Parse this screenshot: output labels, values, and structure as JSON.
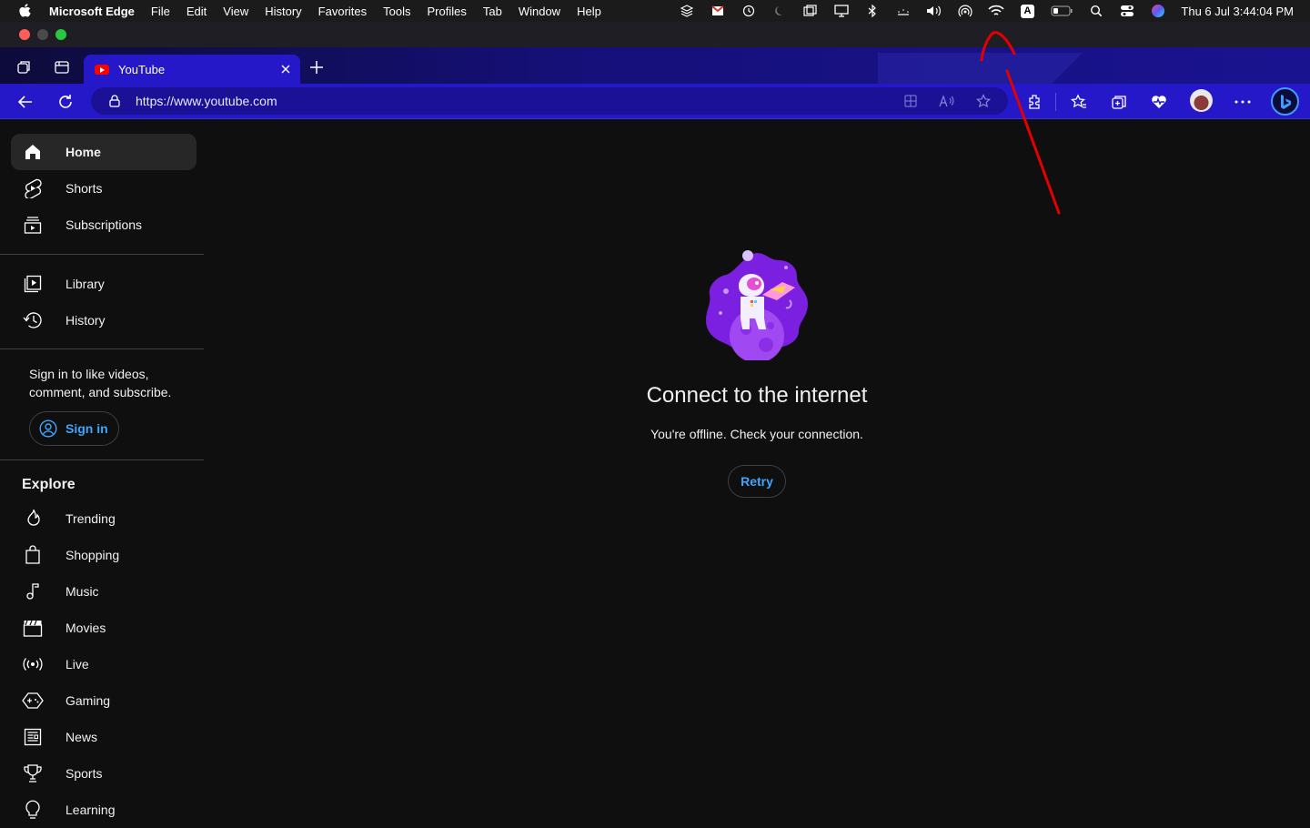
{
  "menubar": {
    "app_name": "Microsoft Edge",
    "items": [
      "File",
      "Edit",
      "View",
      "History",
      "Favorites",
      "Tools",
      "Profiles",
      "Tab",
      "Window",
      "Help"
    ],
    "clock": "Thu 6 Jul  3:44:04 PM",
    "input_source": "A"
  },
  "browser": {
    "tab_title": "YouTube",
    "url": "https://www.youtube.com",
    "accent_color": "#2418c9"
  },
  "sidebar": {
    "primary": [
      {
        "label": "Home",
        "icon": "home-icon"
      },
      {
        "label": "Shorts",
        "icon": "shorts-icon"
      },
      {
        "label": "Subscriptions",
        "icon": "subscriptions-icon"
      }
    ],
    "library": [
      {
        "label": "Library",
        "icon": "library-icon"
      },
      {
        "label": "History",
        "icon": "history-icon"
      }
    ],
    "signin_prompt": "Sign in to like videos, comment, and subscribe.",
    "signin_button": "Sign in",
    "explore_heading": "Explore",
    "explore": [
      {
        "label": "Trending",
        "icon": "trending-icon"
      },
      {
        "label": "Shopping",
        "icon": "shopping-icon"
      },
      {
        "label": "Music",
        "icon": "music-icon"
      },
      {
        "label": "Movies",
        "icon": "movies-icon"
      },
      {
        "label": "Live",
        "icon": "live-icon"
      },
      {
        "label": "Gaming",
        "icon": "gaming-icon"
      },
      {
        "label": "News",
        "icon": "news-icon"
      },
      {
        "label": "Sports",
        "icon": "sports-icon"
      },
      {
        "label": "Learning",
        "icon": "learning-icon"
      }
    ]
  },
  "offline": {
    "title": "Connect to the internet",
    "subtitle": "You're offline. Check your connection.",
    "retry_label": "Retry",
    "link_color": "#3ea6ff"
  }
}
